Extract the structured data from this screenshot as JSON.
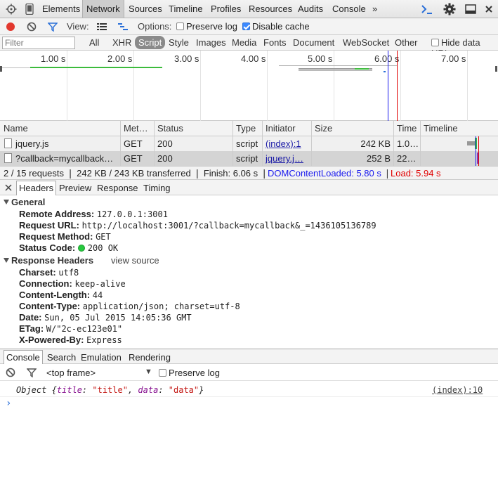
{
  "tabbar": {
    "tabs": [
      "Elements",
      "Network",
      "Sources",
      "Timeline",
      "Profiles",
      "Resources",
      "Audits",
      "Console"
    ],
    "overflow": "»",
    "selected": "Network"
  },
  "nettool": {
    "view_label": "View:",
    "options_label": "Options:",
    "preserve_log": "Preserve log",
    "disable_cache": "Disable cache"
  },
  "filterbar": {
    "placeholder": "Filter",
    "types": [
      "All",
      "XHR",
      "Script",
      "Style",
      "Images",
      "Media",
      "Fonts",
      "Document",
      "WebSocket",
      "Other"
    ],
    "selected": "Script",
    "hide_data_url": "Hide data URI"
  },
  "overview": {
    "ticks": [
      "1.00 s",
      "2.00 s",
      "3.00 s",
      "4.00 s",
      "5.00 s",
      "6.00 s",
      "7.00 s"
    ]
  },
  "table": {
    "headers": [
      "Name",
      "Met…",
      "Status",
      "Type",
      "Initiator",
      "Size",
      "Time",
      "Timeline"
    ],
    "rows": [
      {
        "name": "jquery.js",
        "method": "GET",
        "status": "200",
        "type": "script",
        "initiator": "(index):1",
        "size": "242 KB",
        "time": "1.0…"
      },
      {
        "name": "?callback=mycallback…",
        "method": "GET",
        "status": "200",
        "type": "script",
        "initiator": "jquery.j…",
        "size": "252 B",
        "time": "22…"
      }
    ]
  },
  "summary": {
    "text": "2 / 15 requests ❘ 242 KB / 243 KB transferred ❘ Finish: 6.06 s ❘",
    "dom": "DOMContentLoaded: 5.80 s",
    "sep": "❘",
    "load": "Load: 5.94 s"
  },
  "detail_tabs": [
    "Headers",
    "Preview",
    "Response",
    "Timing"
  ],
  "general": {
    "title": "General",
    "remote_address_k": "Remote Address:",
    "remote_address_v": "127.0.0.1:3001",
    "request_url_k": "Request URL:",
    "request_url_v": "http://localhost:3001/?callback=mycallback&_=1436105136789",
    "request_method_k": "Request Method:",
    "request_method_v": "GET",
    "status_code_k": "Status Code:",
    "status_code_v": "200 OK"
  },
  "response_headers": {
    "title": "Response Headers",
    "view_source": "view source",
    "items": [
      {
        "k": "Charset:",
        "v": "utf8"
      },
      {
        "k": "Connection:",
        "v": "keep-alive"
      },
      {
        "k": "Content-Length:",
        "v": "44"
      },
      {
        "k": "Content-Type:",
        "v": "application/json; charset=utf-8"
      },
      {
        "k": "Date:",
        "v": "Sun, 05 Jul 2015 14:05:36 GMT"
      },
      {
        "k": "ETag:",
        "v": "W/\"2c-ec123e01\""
      },
      {
        "k": "X-Powered-By:",
        "v": "Express"
      }
    ]
  },
  "drawer": {
    "tabs": [
      "Console",
      "Search",
      "Emulation",
      "Rendering"
    ],
    "frame": "<top frame>",
    "preserve_log": "Preserve log"
  },
  "console": {
    "msg_prefix": "Object {",
    "k1": "title",
    "v1": "\"title\"",
    "k2": "data",
    "v2": "\"data\"",
    "msg_suffix": "}",
    "source": "(index):10",
    "prompt": "›"
  },
  "colors": {
    "link": "#1a1aa6",
    "dom_blue": "#1a1aee",
    "load_red": "#e00000",
    "key_purple": "#881391",
    "string_red": "#c41a16"
  }
}
